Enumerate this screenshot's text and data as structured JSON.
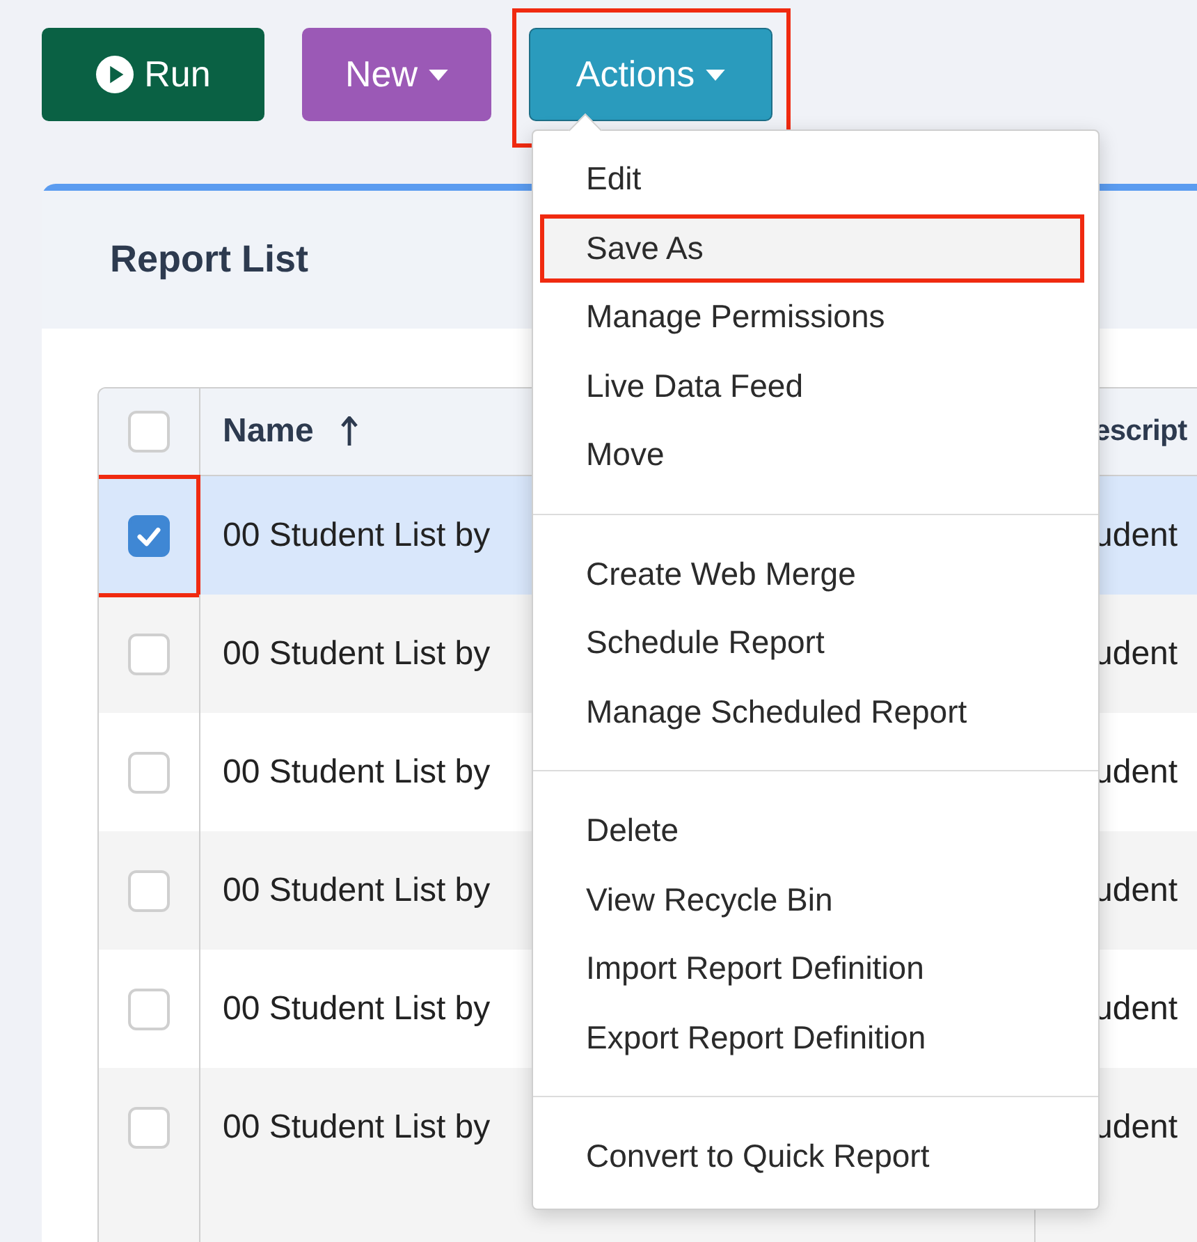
{
  "toolbar": [
    {
      "kind": "run",
      "label": "Run",
      "highlighted": false
    },
    {
      "kind": "new",
      "label": "New",
      "highlighted": false
    },
    {
      "kind": "actions",
      "label": "Actions",
      "highlighted": true
    }
  ],
  "actions_menu": {
    "groups": [
      [
        {
          "label": "Edit",
          "selected": false,
          "highlighted": false
        },
        {
          "label": "Save As",
          "selected": true,
          "highlighted": true
        },
        {
          "label": "Manage Permissions",
          "selected": false,
          "highlighted": false
        },
        {
          "label": "Live Data Feed",
          "selected": false,
          "highlighted": false
        },
        {
          "label": "Move",
          "selected": false,
          "highlighted": false
        }
      ],
      [
        {
          "label": "Create Web Merge",
          "selected": false,
          "highlighted": false
        },
        {
          "label": "Schedule Report",
          "selected": false,
          "highlighted": false
        },
        {
          "label": "Manage Scheduled Report",
          "selected": false,
          "highlighted": false
        }
      ],
      [
        {
          "label": "Delete",
          "selected": false,
          "highlighted": false
        },
        {
          "label": "View Recycle Bin",
          "selected": false,
          "highlighted": false
        },
        {
          "label": "Import Report Definition",
          "selected": false,
          "highlighted": false
        },
        {
          "label": "Export Report Definition",
          "selected": false,
          "highlighted": false
        }
      ],
      [
        {
          "label": "Convert to Quick Report",
          "selected": false,
          "highlighted": false
        }
      ]
    ]
  },
  "panel": {
    "title": "Report List",
    "table": {
      "columns": [
        "Name",
        "escript"
      ],
      "header_checked": false,
      "rows": [
        {
          "name": "00 Student List by",
          "description": "udent",
          "selected": true,
          "highlighted": true
        },
        {
          "name": "00 Student List by",
          "description": "udent",
          "selected": false,
          "highlighted": false
        },
        {
          "name": "00 Student List by",
          "description": "udent",
          "selected": false,
          "highlighted": false
        },
        {
          "name": "00 Student List by",
          "description": "udent",
          "selected": false,
          "highlighted": false
        },
        {
          "name": "00 Student List by",
          "description": "udent",
          "selected": false,
          "highlighted": false
        },
        {
          "name": "00 Student List by",
          "description": "udent",
          "selected": false,
          "highlighted": false
        }
      ]
    }
  }
}
